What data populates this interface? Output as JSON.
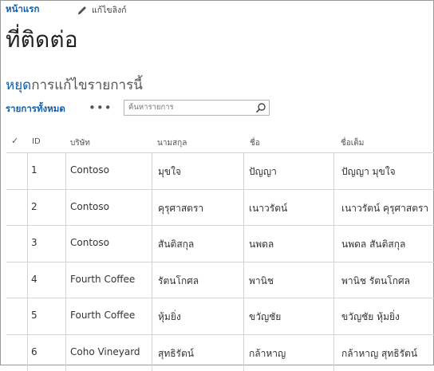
{
  "nav": {
    "home": "หน้าแรก",
    "edit_links": "แก้ไขลิงก์"
  },
  "page": {
    "title": "ที่ติดต่อ"
  },
  "edit_mode": {
    "stop_link": "หยุด",
    "rest": "การแก้ไขรายการนี้"
  },
  "view": {
    "all_items": "รายการทั้งหมด",
    "more": "•••"
  },
  "search": {
    "placeholder": "ค้นหารายการ"
  },
  "columns": {
    "check": "✓",
    "id": "ID",
    "company": "บริษัท",
    "last_name": "นามสกุล",
    "first_name": "ชื่อ",
    "full_name": "ชื่อเต็ม"
  },
  "rows": [
    {
      "id": "1",
      "company": "Contoso",
      "last_name": "มุขใจ",
      "first_name": "ปัญญา",
      "full_name": "ปัญญา มุขใจ"
    },
    {
      "id": "2",
      "company": "Contoso",
      "last_name": "คุรุศาสตรา",
      "first_name": "เนาวรัตน์",
      "full_name": "เนาวรัตน์ คุรุศาสตรา"
    },
    {
      "id": "3",
      "company": "Contoso",
      "last_name": "สันติสกุล",
      "first_name": "นพดล",
      "full_name": "นพดล สันติสกุล"
    },
    {
      "id": "4",
      "company": "Fourth Coffee",
      "last_name": "รัตนโกศล",
      "first_name": "พานิช",
      "full_name": "พานิช รัตนโกศล"
    },
    {
      "id": "5",
      "company": "Fourth Coffee",
      "last_name": "หุ้มยิ่ง",
      "first_name": "ขวัญชัย",
      "full_name": "ขวัญชัย หุ้มยิ่ง"
    },
    {
      "id": "6",
      "company": "Coho Vineyard",
      "last_name": "สุทธิรัตน์",
      "first_name": "กล้าหาญ",
      "full_name": "กล้าหาญ สุทธิรัตน์"
    }
  ],
  "colors": {
    "link": "#0f5ea8",
    "border": "#d4d4d4"
  }
}
